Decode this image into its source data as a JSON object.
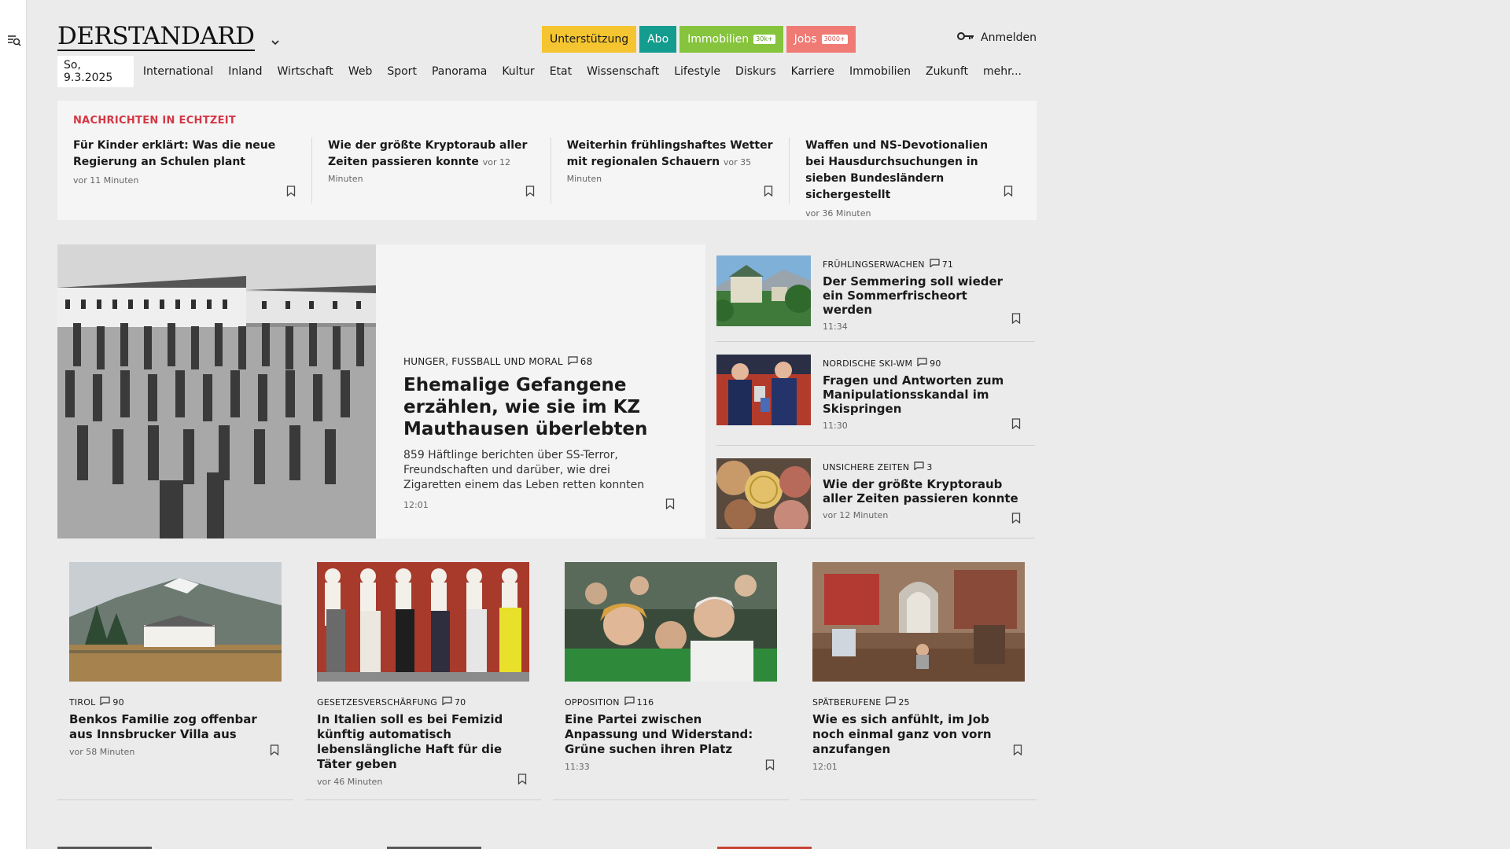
{
  "header": {
    "logo": "DERSTANDARD",
    "promo": {
      "support": "Unterstützung",
      "abo": "Abo",
      "immo": "Immobilien",
      "immo_badge": "30k+",
      "jobs": "Jobs",
      "jobs_badge": "3000+"
    },
    "login": "Anmelden"
  },
  "nav": {
    "date": "So, 9.3.2025",
    "items": [
      "International",
      "Inland",
      "Wirtschaft",
      "Web",
      "Sport",
      "Panorama",
      "Kultur",
      "Etat",
      "Wissenschaft",
      "Lifestyle",
      "Diskurs",
      "Karriere",
      "Immobilien",
      "Zukunft",
      "mehr..."
    ]
  },
  "ticker": {
    "kicker": "NACHRICHTEN IN ECHTZEIT",
    "items": [
      {
        "title": "Für Kinder erklärt: Was die neue Regierung an Schulen plant",
        "time": "vor 11 Minuten"
      },
      {
        "title": "Wie der größte Kryptoraub aller Zeiten passieren konnte",
        "time": "vor 12 Minuten"
      },
      {
        "title": "Weiterhin frühlingshaftes Wetter mit regionalen Schauern",
        "time": "vor 35 Minuten"
      },
      {
        "title": "Waffen und NS-Devotionalien bei Hausdurchsuchungen in sieben Bundesländern sichergestellt",
        "time": "vor 36 Minuten"
      }
    ]
  },
  "lead": {
    "kicker": "HUNGER, FUSSBALL UND MORAL",
    "comments": "68",
    "title": "Ehemalige Gefangene erzählen, wie sie im KZ Mauthausen überlebten",
    "teaser": "859 Häftlinge berichten über SS-Terror, Freundschaften und darüber, wie drei Zigaretten einem das Leben retten konnten",
    "time": "12:01"
  },
  "side": [
    {
      "kicker": "FRÜHLINGSERWACHEN",
      "comments": "71",
      "title": "Der Semmering soll wieder ein Sommerfrischeort werden",
      "time": "11:34"
    },
    {
      "kicker": "NORDISCHE SKI-WM",
      "comments": "90",
      "title": "Fragen und Antworten zum Manipulationsskandal im Skispringen",
      "time": "11:30"
    },
    {
      "kicker": "UNSICHERE ZEITEN",
      "comments": "3",
      "title": "Wie der größte Kryptoraub aller Zeiten passieren konnte",
      "time": "vor 12 Minuten"
    }
  ],
  "cards": [
    {
      "kicker": "TIROL",
      "comments": "90",
      "title": "Benkos Familie zog offenbar aus Innsbrucker Villa aus",
      "time": "vor 58 Minuten"
    },
    {
      "kicker": "GESETZESVERSCHÄRFUNG",
      "comments": "70",
      "title": "In Italien soll es bei Femizid künftig automatisch lebenslängliche Haft für die Täter geben",
      "time": "vor 46 Minuten"
    },
    {
      "kicker": "OPPOSITION",
      "comments": "116",
      "title": "Eine Partei zwischen Anpassung und Widerstand: Grüne suchen ihren Platz",
      "time": "11:33"
    },
    {
      "kicker": "SPÄTBERUFENE",
      "comments": "25",
      "title": "Wie es sich anfühlt, im Job noch einmal ganz von vorn anzufangen",
      "time": "12:01"
    }
  ],
  "colors": {
    "accent_red": "#d33745",
    "support": "#f5c531",
    "abo": "#149c8e",
    "immo": "#85c43c",
    "jobs": "#f07a74"
  },
  "icons": [
    "menu-search-icon",
    "chevron-down-icon",
    "key-icon",
    "bookmark-icon",
    "comment-icon"
  ]
}
